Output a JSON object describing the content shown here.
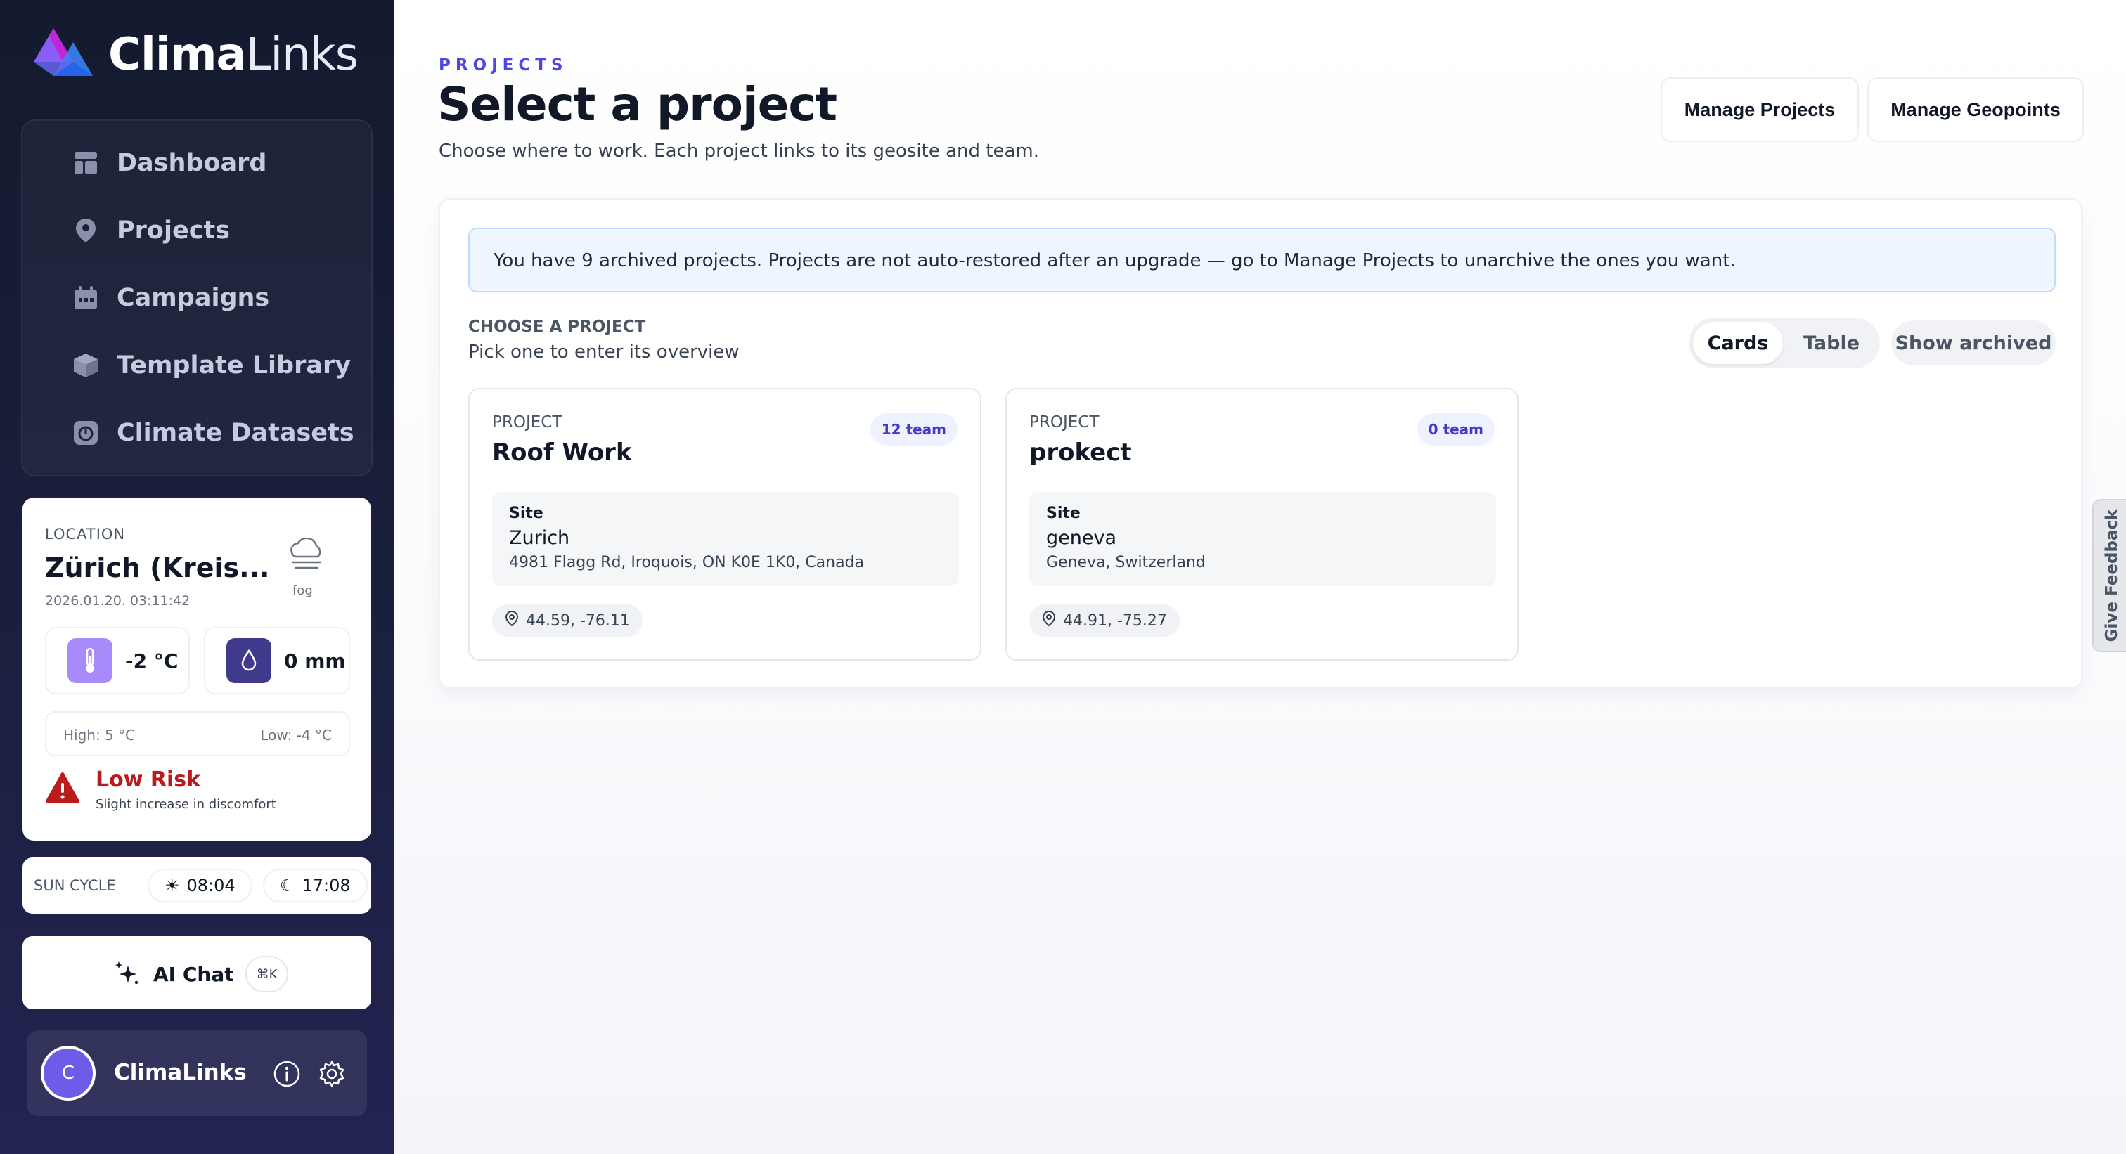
{
  "brand": {
    "name_bold": "Clima",
    "name_light": "Links"
  },
  "nav": {
    "items": [
      {
        "label": "Dashboard",
        "icon": "dashboard-icon"
      },
      {
        "label": "Projects",
        "icon": "map-pin-icon"
      },
      {
        "label": "Campaigns",
        "icon": "calendar-icon"
      },
      {
        "label": "Template Library",
        "icon": "cube-icon"
      },
      {
        "label": "Climate Datasets",
        "icon": "dataset-icon"
      }
    ]
  },
  "weather": {
    "location_label": "LOCATION",
    "city": "Zürich (Kreis...",
    "timestamp": "2026.01.20. 03:11:42",
    "condition": "fog",
    "temperature": "-2 °C",
    "precipitation": "0 mm",
    "high": "High: 5 °C",
    "low": "Low: -4 °C",
    "risk_title": "Low Risk",
    "risk_sub": "Slight increase in discomfort",
    "temp_color": "#a78bfa",
    "precip_color": "#3f3a8c",
    "risk_color": "#b91c1c"
  },
  "sun": {
    "label": "SUN CYCLE",
    "sunrise": "08:04",
    "sunset": "17:08"
  },
  "chat": {
    "label": "AI Chat",
    "shortcut": "⌘K"
  },
  "user": {
    "initial": "C",
    "name": "ClimaLinks"
  },
  "header": {
    "eyebrow": "PROJECTS",
    "title": "Select a project",
    "subtitle": "Choose where to work. Each project links to its geosite and team.",
    "manage_projects": "Manage Projects",
    "manage_geopoints": "Manage Geopoints"
  },
  "banner": {
    "text": "You have 9 archived projects. Projects are not auto-restored after an upgrade — go to Manage Projects to unarchive the ones you want."
  },
  "chooser": {
    "label": "CHOOSE A PROJECT",
    "sub": "Pick one to enter its overview",
    "view_cards": "Cards",
    "view_table": "Table",
    "active_view": "Cards",
    "show_archived": "Show archived"
  },
  "projects": [
    {
      "label": "PROJECT",
      "name": "Roof Work",
      "team": "12 team",
      "site_label": "Site",
      "site_name": "Zurich",
      "site_address": "4981 Flagg Rd, Iroquois, ON K0E 1K0, Canada",
      "coords": "44.59, -76.11"
    },
    {
      "label": "PROJECT",
      "name": "prokect",
      "team": "0 team",
      "site_label": "Site",
      "site_name": "geneva",
      "site_address": "Geneva, Switzerland",
      "coords": "44.91, -75.27"
    }
  ],
  "feedback": {
    "label": "Give Feedback"
  },
  "colors": {
    "accent": "#4f46e5",
    "sidebar": "#161b33",
    "banner_bg": "#eff6ff"
  }
}
